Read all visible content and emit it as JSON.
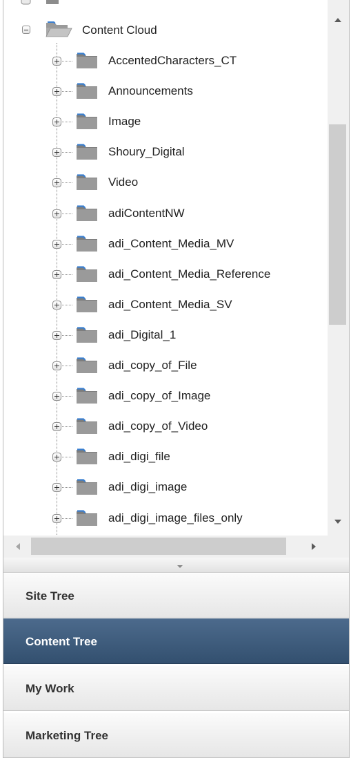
{
  "tree": {
    "root": {
      "label": "Content Cloud",
      "expanded": true,
      "icon": "open-folder-icon"
    },
    "children": [
      {
        "label": "AccentedCharacters_CT"
      },
      {
        "label": "Announcements"
      },
      {
        "label": "Image"
      },
      {
        "label": "Shoury_Digital"
      },
      {
        "label": "Video"
      },
      {
        "label": "adiContentNW"
      },
      {
        "label": "adi_Content_Media_MV"
      },
      {
        "label": "adi_Content_Media_Reference"
      },
      {
        "label": "adi_Content_Media_SV"
      },
      {
        "label": "adi_Digital_1"
      },
      {
        "label": "adi_copy_of_File"
      },
      {
        "label": "adi_copy_of_Image"
      },
      {
        "label": "adi_copy_of_Video"
      },
      {
        "label": "adi_digi_file"
      },
      {
        "label": "adi_digi_image"
      },
      {
        "label": "adi_digi_image_files_only"
      }
    ],
    "child_icon": "folder-icon",
    "expander_icon": "plus-box-icon"
  },
  "tabs": [
    {
      "label": "Site Tree",
      "active": false
    },
    {
      "label": "Content Tree",
      "active": true
    },
    {
      "label": "My Work",
      "active": false
    },
    {
      "label": "Marketing Tree",
      "active": false
    }
  ],
  "colors": {
    "active_tab": "#3d5a7b",
    "inactive_tab": "#ececec",
    "folder_body": "#8c8c8c",
    "folder_accent": "#3a7fd0"
  }
}
